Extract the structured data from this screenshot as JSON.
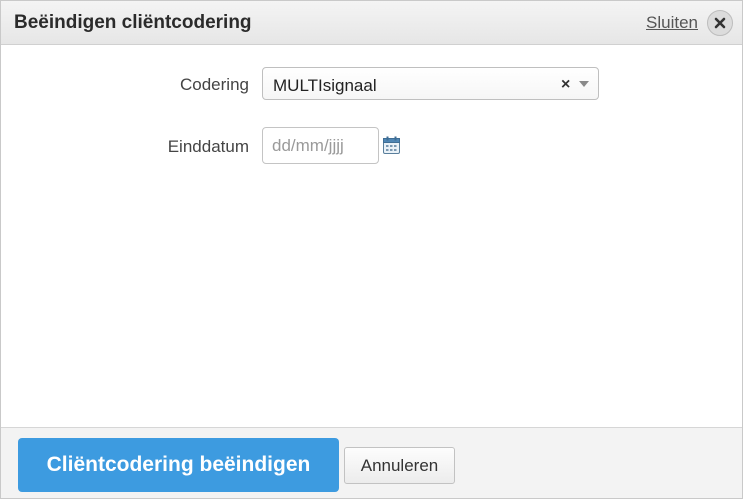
{
  "dialog": {
    "title": "Beëindigen cliëntcodering",
    "close_link": "Sluiten",
    "close_icon": "close-icon"
  },
  "form": {
    "codering": {
      "label": "Codering",
      "value": "MULTIsignaal",
      "clear_symbol": "×"
    },
    "einddatum": {
      "label": "Einddatum",
      "value": "",
      "placeholder": "dd/mm/jjjj",
      "icon": "calendar-icon"
    }
  },
  "footer": {
    "primary_label": "Cliëntcodering beëindigen",
    "secondary_label": "Annuleren"
  },
  "colors": {
    "primary": "#3d9be0",
    "header_bg": "#ececec",
    "footer_bg": "#f3f3f3"
  }
}
